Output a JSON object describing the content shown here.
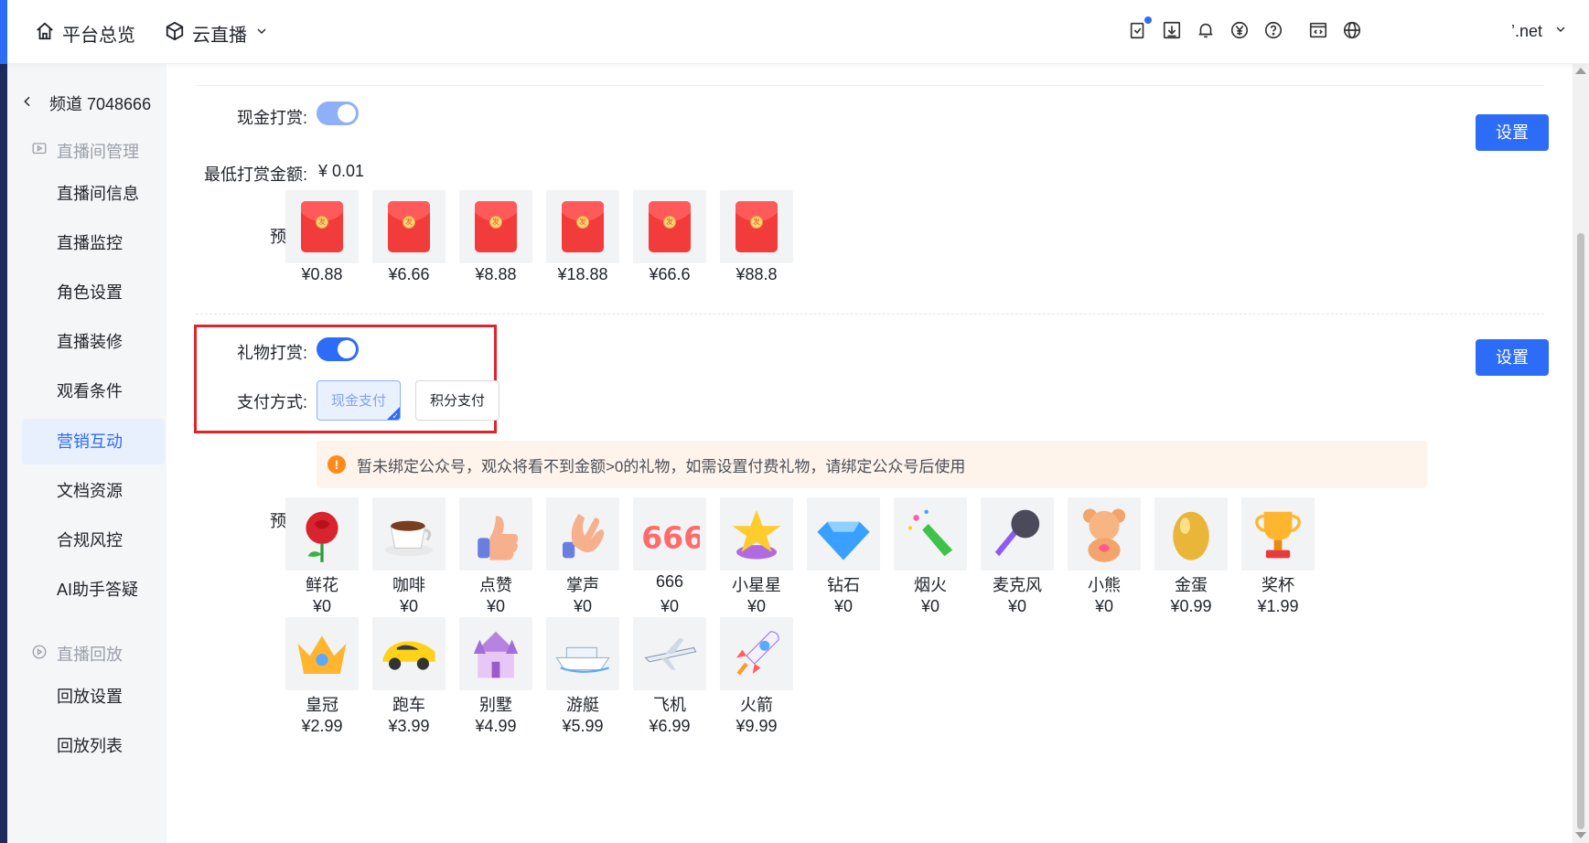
{
  "colors": {
    "primary": "#2d6cf6",
    "toggle_off_tint": "#8eb0f8",
    "highlight_red": "#e0242b",
    "notice_bg": "#fff4ec",
    "divider": "#e8ebf0"
  },
  "topbar": {
    "nav": [
      {
        "label": "平台总览",
        "icon": "home-icon"
      },
      {
        "label": "云直播",
        "icon": "cube-icon"
      }
    ],
    "icons": [
      "checklist-icon",
      "download-icon",
      "bell-icon",
      "yen-icon",
      "help-icon",
      "code-window-icon",
      "globe-icon"
    ],
    "account": "’.net"
  },
  "sidebar": {
    "back_label": "频道 7048666",
    "groups": [
      {
        "label": "直播间管理",
        "icon": "play-window-icon"
      },
      {
        "label": "直播回放",
        "icon": "replay-icon"
      }
    ],
    "items": [
      {
        "label": "直播间信息"
      },
      {
        "label": "直播监控"
      },
      {
        "label": "角色设置"
      },
      {
        "label": "直播装修"
      },
      {
        "label": "观看条件"
      },
      {
        "label": "营销互动",
        "active": true
      },
      {
        "label": "文档资源"
      },
      {
        "label": "合规风控"
      },
      {
        "label": "AI助手答疑"
      }
    ],
    "replay_items": [
      {
        "label": "回放设置"
      },
      {
        "label": "回放列表"
      }
    ]
  },
  "cash_reward": {
    "label": "现金打赏:",
    "enabled": true,
    "min_label": "最低打赏金额:",
    "min_value": "¥ 0.01",
    "settings_button": "设置",
    "preview_label": "预览:",
    "amounts": [
      "¥0.88",
      "¥6.66",
      "¥8.88",
      "¥18.88",
      "¥66.6",
      "¥88.8"
    ],
    "envelope_glyph": "发"
  },
  "gift_reward": {
    "label": "礼物打赏:",
    "enabled": true,
    "pay_label": "支付方式:",
    "pay_options": [
      {
        "label": "现金支付",
        "selected": true
      },
      {
        "label": "积分支付",
        "selected": false
      }
    ],
    "settings_button": "设置",
    "notice": "暂未绑定公众号，观众将看不到金额>0的礼物，如需设置付费礼物，请绑定公众号后使用",
    "notice_icon": "!",
    "preview_label": "预览:",
    "gifts": [
      {
        "name": "鲜花",
        "price": "¥0",
        "icon": "rose-icon"
      },
      {
        "name": "咖啡",
        "price": "¥0",
        "icon": "coffee-icon"
      },
      {
        "name": "点赞",
        "price": "¥0",
        "icon": "thumbs-up-icon"
      },
      {
        "name": "掌声",
        "price": "¥0",
        "icon": "clap-icon"
      },
      {
        "name": "666",
        "price": "¥0",
        "icon": "666-icon"
      },
      {
        "name": "小星星",
        "price": "¥0",
        "icon": "star-icon"
      },
      {
        "name": "钻石",
        "price": "¥0",
        "icon": "diamond-icon"
      },
      {
        "name": "烟火",
        "price": "¥0",
        "icon": "firework-icon"
      },
      {
        "name": "麦克风",
        "price": "¥0",
        "icon": "microphone-icon"
      },
      {
        "name": "小熊",
        "price": "¥0",
        "icon": "bear-icon"
      },
      {
        "name": "金蛋",
        "price": "¥0.99",
        "icon": "golden-egg-icon"
      },
      {
        "name": "奖杯",
        "price": "¥1.99",
        "icon": "trophy-icon"
      },
      {
        "name": "皇冠",
        "price": "¥2.99",
        "icon": "crown-icon"
      },
      {
        "name": "跑车",
        "price": "¥3.99",
        "icon": "sports-car-icon"
      },
      {
        "name": "别墅",
        "price": "¥4.99",
        "icon": "villa-icon"
      },
      {
        "name": "游艇",
        "price": "¥5.99",
        "icon": "yacht-icon"
      },
      {
        "name": "飞机",
        "price": "¥6.99",
        "icon": "airplane-icon"
      },
      {
        "name": "火箭",
        "price": "¥9.99",
        "icon": "rocket-icon"
      }
    ]
  }
}
